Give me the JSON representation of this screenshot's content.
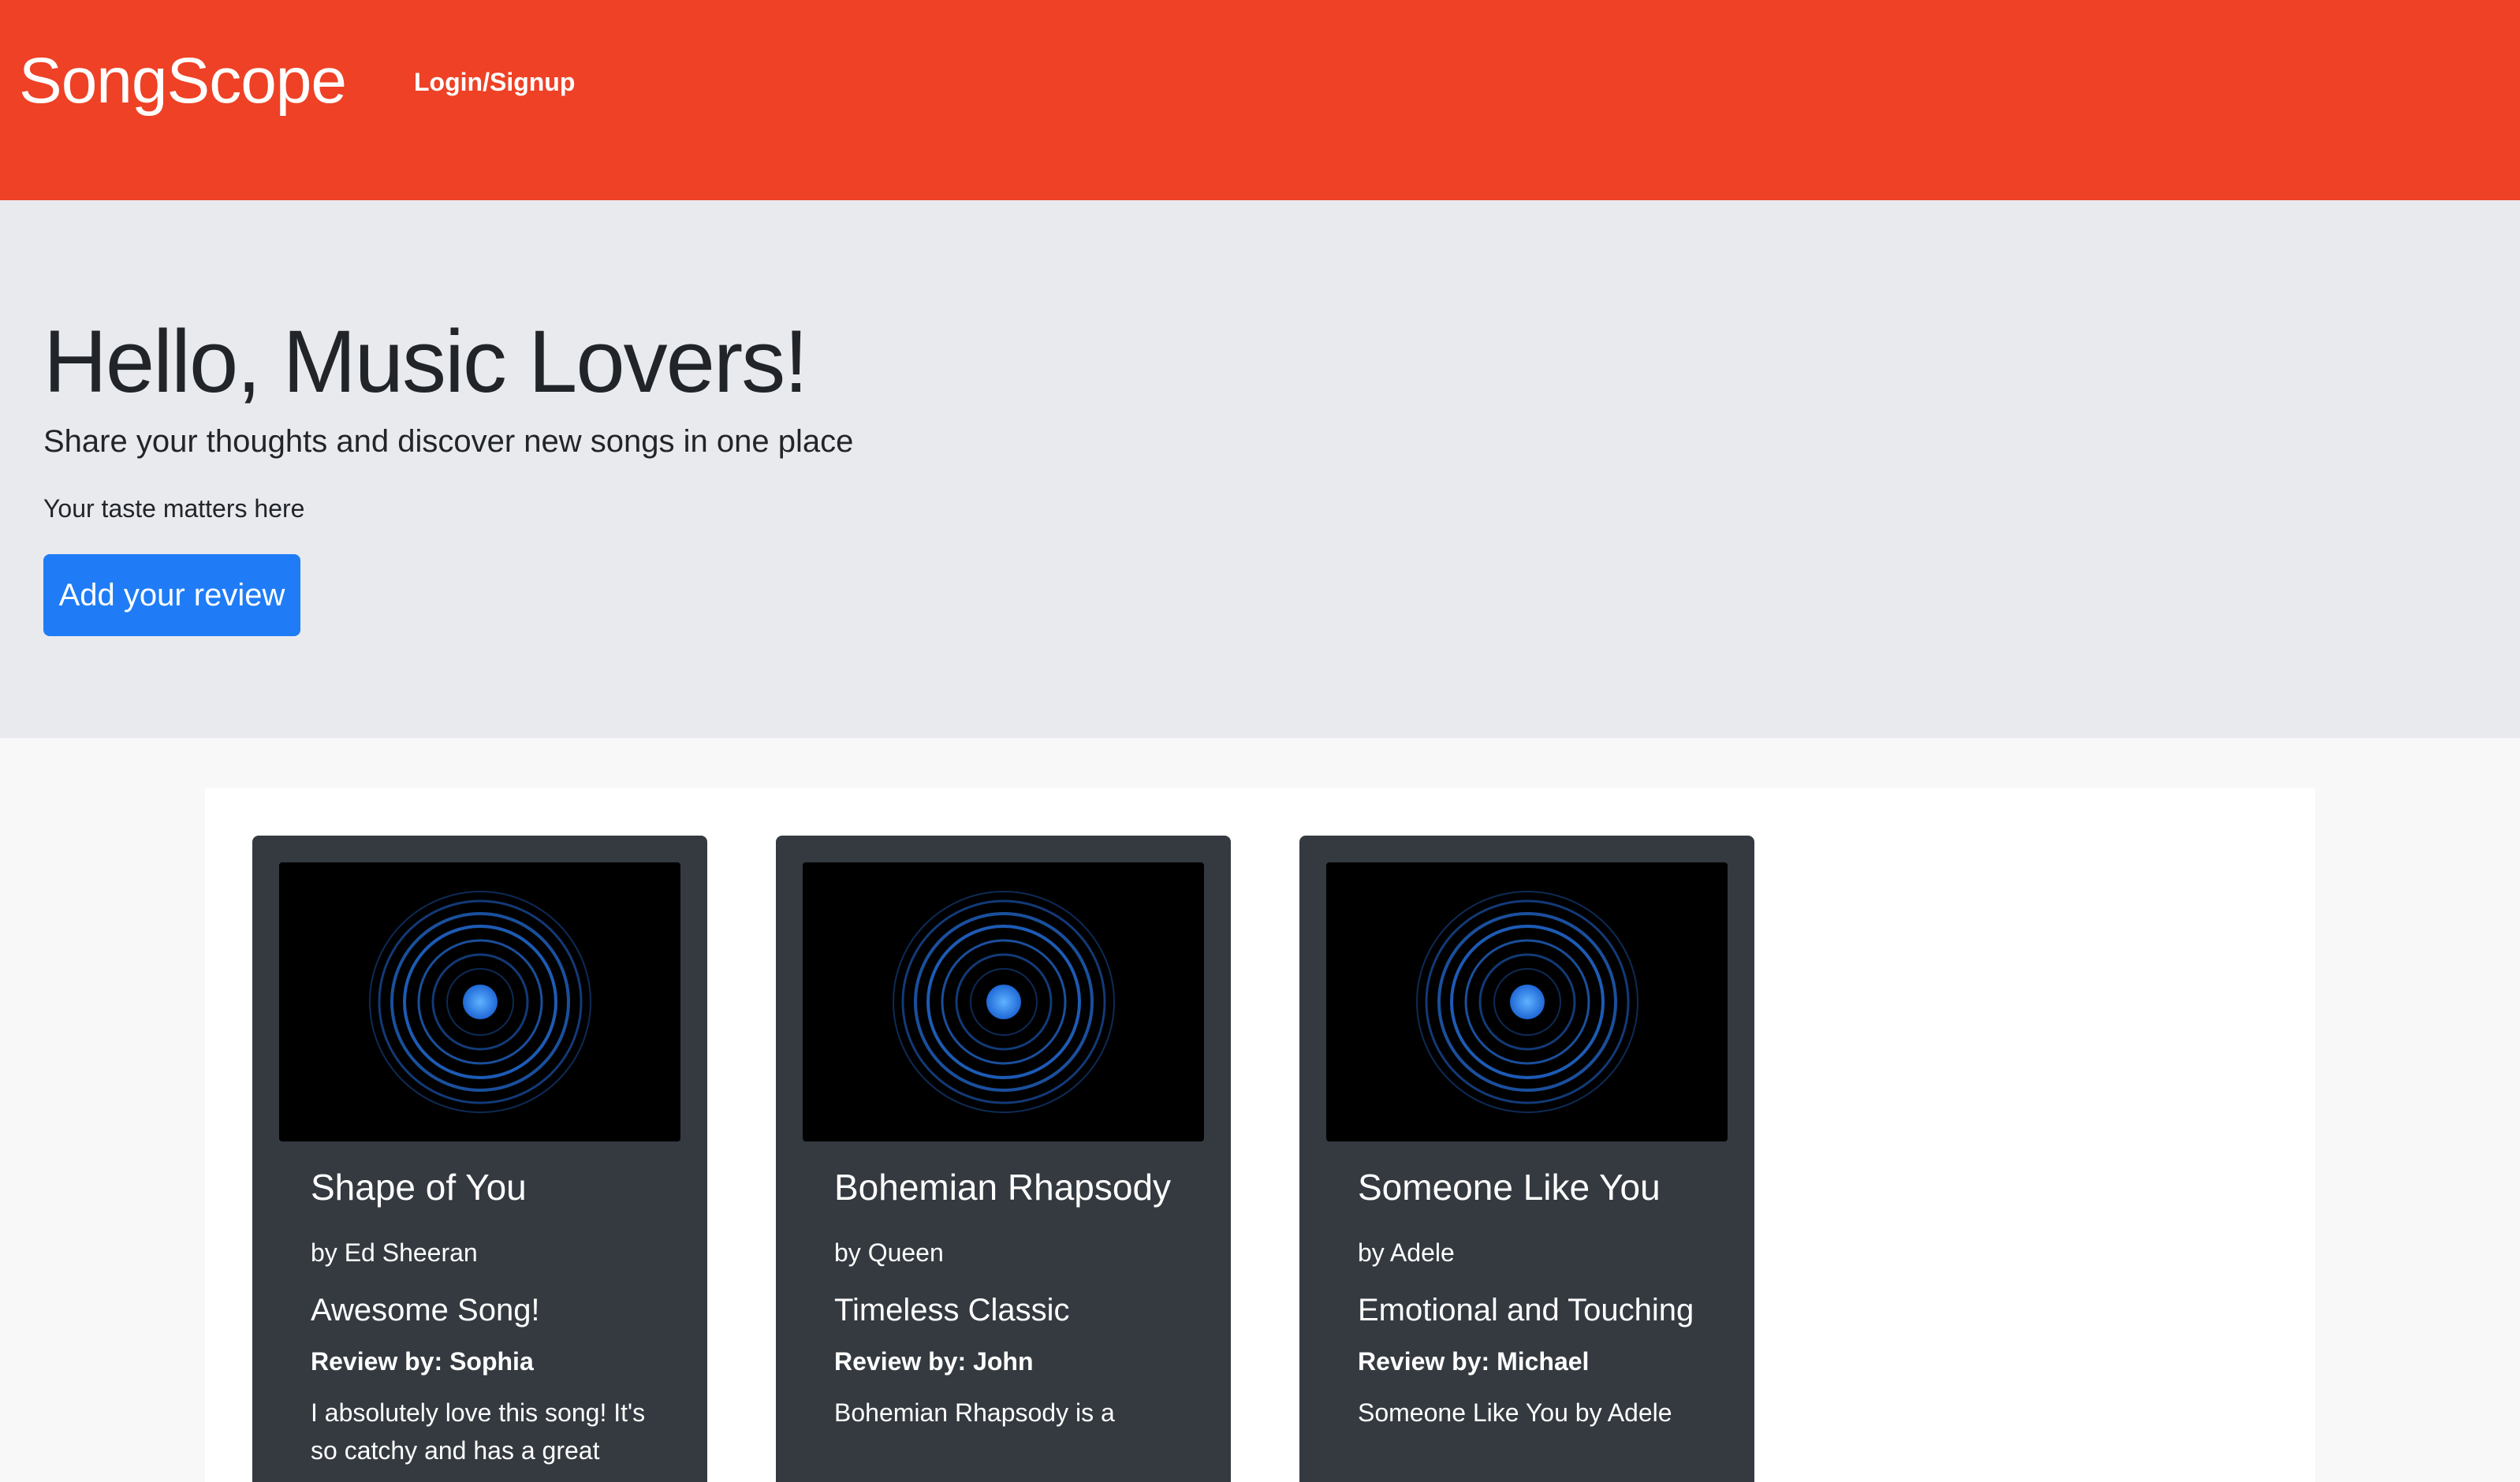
{
  "navbar": {
    "brand": "SongScope",
    "login_link": "Login/Signup",
    "background_color": "#ee4126"
  },
  "hero": {
    "title": "Hello, Music Lovers!",
    "lead": "Share your thoughts and discover new songs in one place",
    "subtext": "Your taste matters here",
    "button_label": "Add your review",
    "button_color": "#1f7cf6"
  },
  "cards": [
    {
      "image_icon": "sound-wave-circles-icon",
      "title": "Shape of You",
      "artist": "by Ed Sheeran",
      "review_title": "Awesome Song!",
      "reviewer": "Review by: Sophia",
      "review_text": "I absolutely love this song! It's so catchy and has a great"
    },
    {
      "image_icon": "sound-wave-circles-icon",
      "title": "Bohemian Rhapsody",
      "artist": "by Queen",
      "review_title": "Timeless Classic",
      "reviewer": "Review by: John",
      "review_text": "Bohemian Rhapsody is a"
    },
    {
      "image_icon": "sound-wave-circles-icon",
      "title": "Someone Like You",
      "artist": "by Adele",
      "review_title": "Emotional and Touching",
      "reviewer": "Review by: Michael",
      "review_text": "Someone Like You by Adele"
    }
  ]
}
